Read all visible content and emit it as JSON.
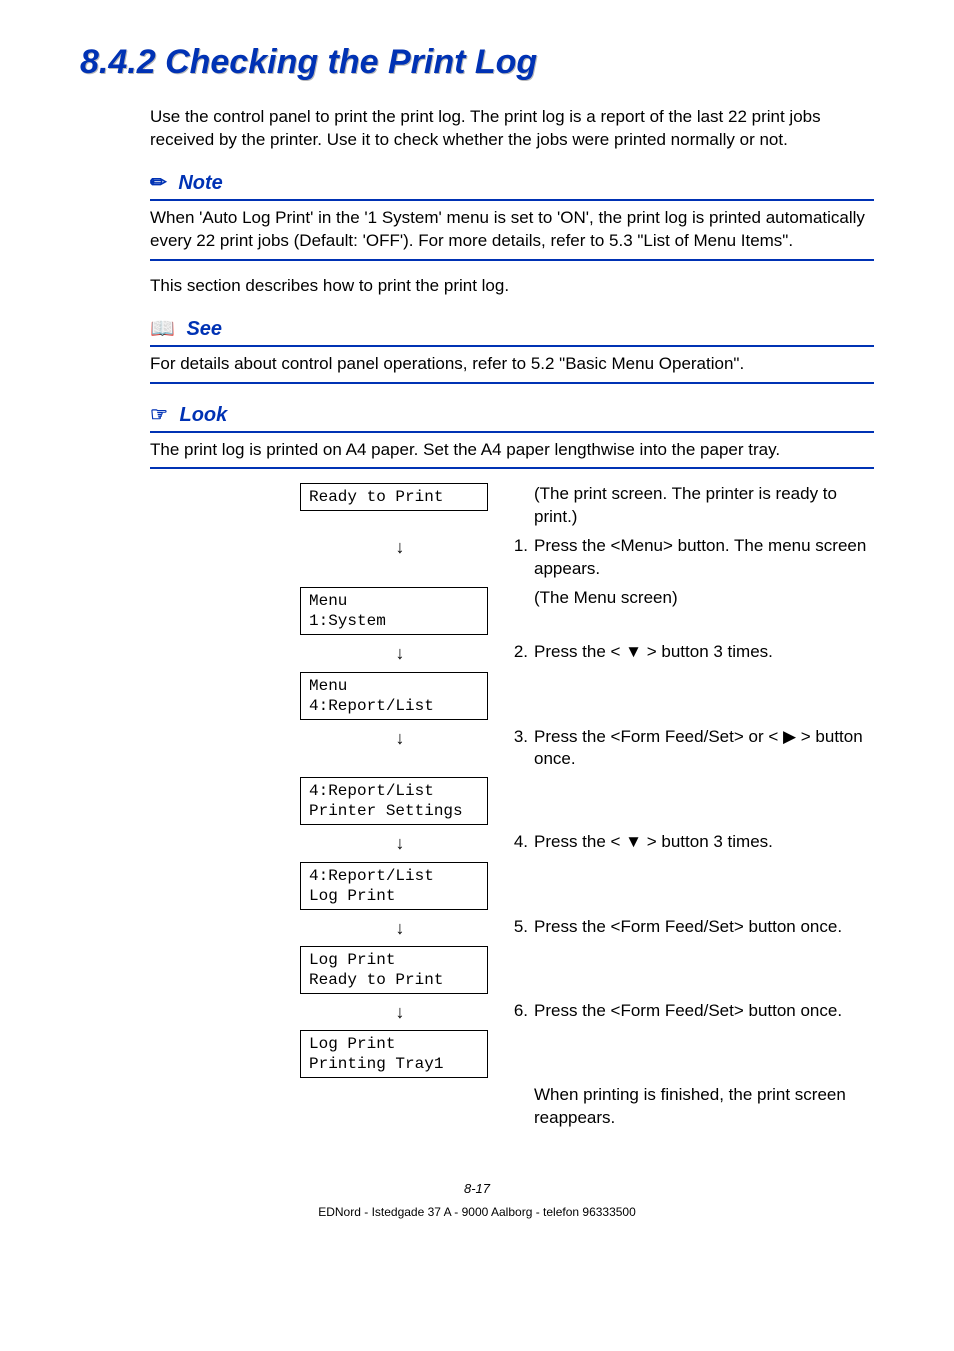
{
  "title": "8.4.2  Checking the Print Log",
  "intro": "Use the control panel to print the print log. The print log is a report of the last 22 print jobs received by the printer. Use it to check whether the jobs were printed normally or not.",
  "note": {
    "label": "Note",
    "text": "When 'Auto Log Print' in the '1 System' menu is set to 'ON', the print log is printed automatically every 22 print jobs (Default: 'OFF'). For more details, refer to 5.3 \"List of Menu Items\"."
  },
  "mid": "This section describes how to print the print log.",
  "see": {
    "label": "See",
    "text": "For details about control panel operations, refer to 5.2 \"Basic Menu Operation\"."
  },
  "look": {
    "label": "Look",
    "text": "The print log is printed on A4 paper. Set the A4 paper lengthwise into the paper tray."
  },
  "steps": {
    "lcd0": "Ready to Print",
    "desc0": "(The print screen. The printer is ready to print.)",
    "s1": "Press the <Menu> button. The menu screen appears.",
    "lcd1": "Menu\n1:System",
    "desc1": "(The Menu screen)",
    "s2": "Press the < ▼ > button 3 times.",
    "lcd2": "Menu\n4:Report/List",
    "s3": "Press the <Form Feed/Set> or < ▶ > button once.",
    "lcd3": "4:Report/List\nPrinter Settings",
    "s4": "Press the < ▼ > button 3 times.",
    "lcd4": "4:Report/List\nLog Print",
    "s5": "Press the <Form Feed/Set> button once.",
    "lcd5": "Log Print\nReady to Print",
    "s6": "Press the <Form Feed/Set> button once.",
    "lcd6": "Log Print\nPrinting Tray1",
    "final": "When printing is finished, the print screen reappears."
  },
  "pagenum": "8-17",
  "footer": "EDNord - Istedgade 37 A - 9000 Aalborg - telefon 96333500"
}
